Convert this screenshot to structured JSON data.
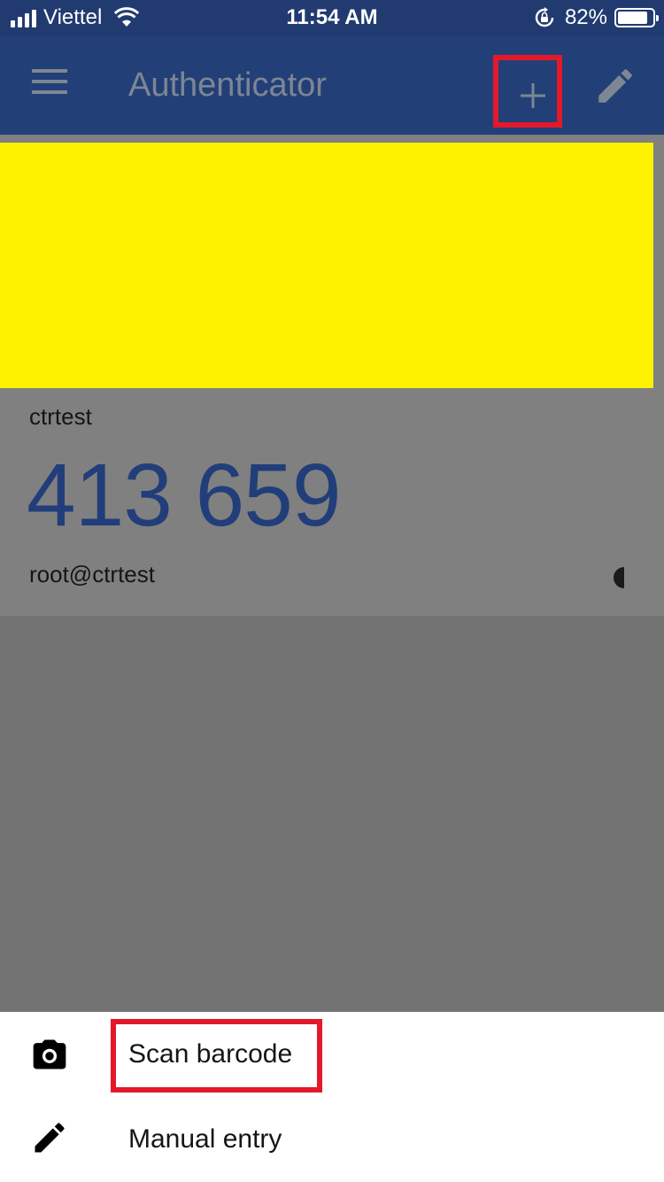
{
  "status_bar": {
    "carrier": "Viettel",
    "time": "11:54 AM",
    "battery_percent": "82%",
    "battery_level": 0.82
  },
  "app_bar": {
    "title": "Authenticator",
    "menu_icon": "menu-icon",
    "add_icon": "plus-icon",
    "edit_icon": "pencil-icon"
  },
  "account": {
    "issuer": "ctrtest",
    "code": "413 659",
    "name": "root@ctrtest",
    "code_color": "#213e7a",
    "timer_icon": "countdown-icon"
  },
  "sheet": {
    "items": [
      {
        "label": "Scan barcode",
        "icon": "camera-icon"
      },
      {
        "label": "Manual entry",
        "icon": "pencil-icon"
      }
    ]
  },
  "colors": {
    "app_bar": "#223f77",
    "highlight": "#e3192b",
    "redaction": "#fff200"
  }
}
